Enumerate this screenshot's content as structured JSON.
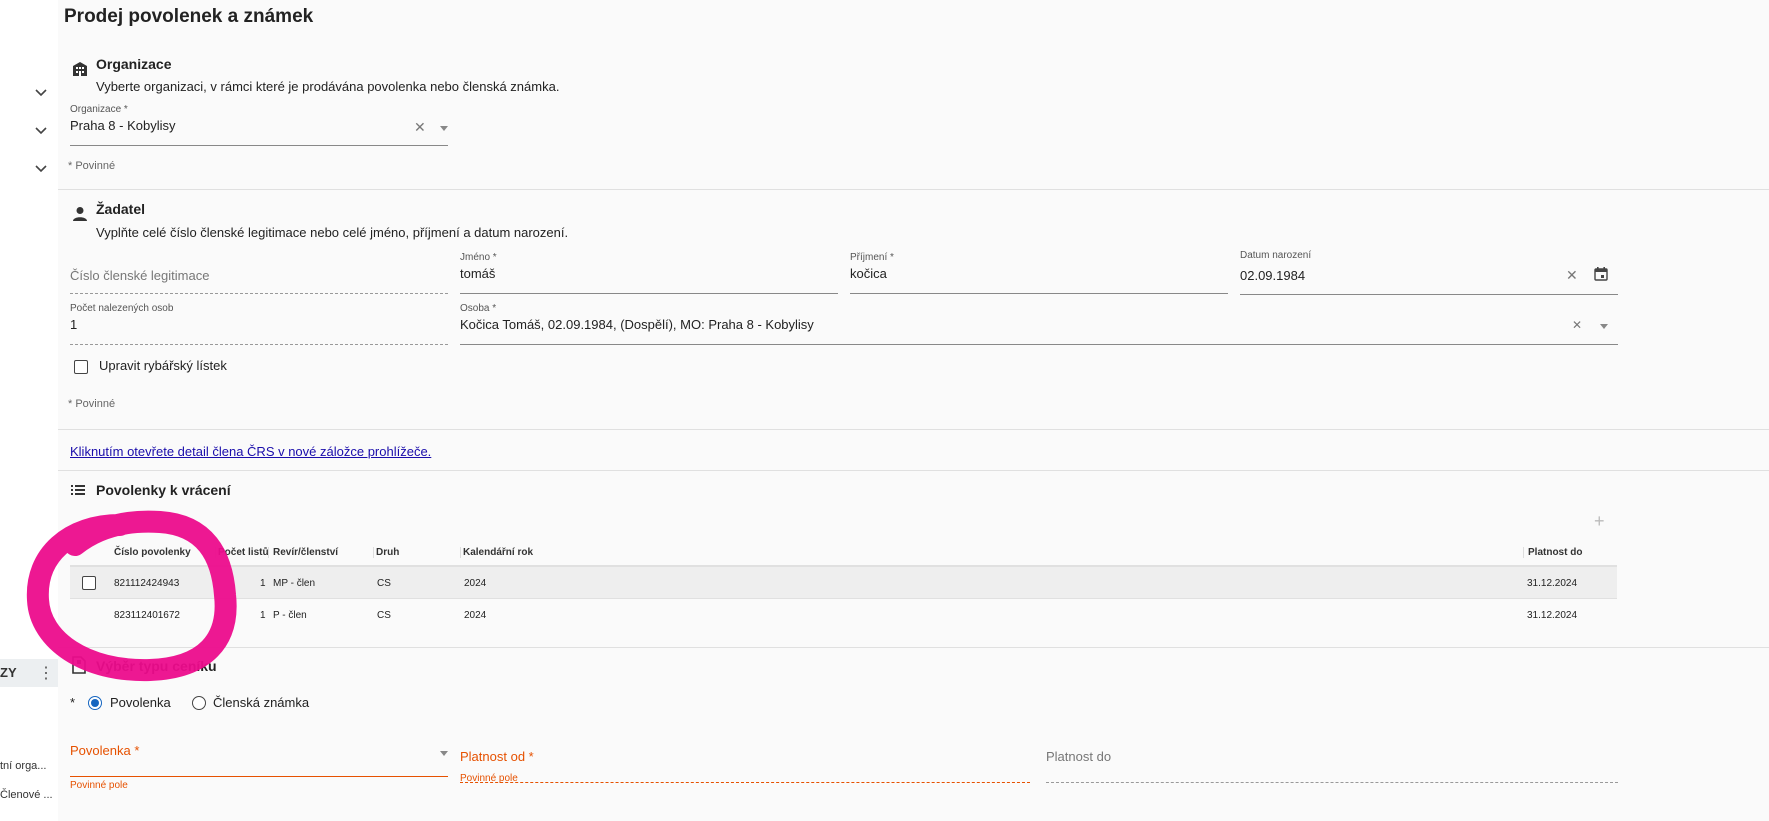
{
  "sidebar": {
    "menu_label": "ZY",
    "items": [
      "tní orga...",
      "Členové ..."
    ]
  },
  "page": {
    "title": "Prodej povolenek a známek"
  },
  "organizace": {
    "title": "Organizace",
    "desc": "Vyberte organizaci, v rámci které je prodávána povolenka nebo členská známka.",
    "field_label": "Organizace *",
    "field_value": "Praha 8 - Kobylisy",
    "required_note": "* Povinné"
  },
  "zadatel": {
    "title": "Žadatel",
    "desc": "Vyplňte celé číslo členské legitimace nebo celé jméno, příjmení a datum narození.",
    "cislo_placeholder": "Číslo členské legitimace",
    "jmeno_label": "Jméno *",
    "jmeno_value": "tomáš",
    "prijmeni_label": "Příjmení *",
    "prijmeni_value": "kočica",
    "datum_label": "Datum narození",
    "datum_value": "02.09.1984",
    "pocet_label": "Počet nalezených osob",
    "pocet_value": "1",
    "osoba_label": "Osoba *",
    "osoba_value": "Kočica Tomáš, 02.09.1984, (Dospělí), MO: Praha 8 - Kobylisy",
    "checkbox_label": "Upravit rybářský lístek",
    "required_note": "* Povinné"
  },
  "link": {
    "text": "Kliknutím otevřete detail člena ČRS v nové záložce prohlížeče."
  },
  "povolenky": {
    "title": "Povolenky k vrácení",
    "add_symbol": "+",
    "columns": [
      "Číslo povolenky",
      "Počet listů",
      "Revír/členství",
      "Druh",
      "Kalendářní rok",
      "Platnost do"
    ],
    "rows": [
      {
        "cislo": "821112424943",
        "pocet": "1",
        "revir": "MP - člen",
        "druh": "CS",
        "rok": "2024",
        "platnost": "31.12.2024"
      },
      {
        "cislo": "823112401672",
        "pocet": "1",
        "revir": "P - člen",
        "druh": "CS",
        "rok": "2024",
        "platnost": "31.12.2024"
      }
    ]
  },
  "cenik": {
    "title": "Výběr typu ceníku",
    "asterisk": "*",
    "options": [
      "Povolenka",
      "Členská známka"
    ],
    "selected": "Povolenka",
    "povolenka_label": "Povolenka *",
    "platnost_od_label": "Platnost od *",
    "platnost_do_label": "Platnost do",
    "error_text": "Povinné pole"
  },
  "colors": {
    "accent": "#1565c0",
    "error": "#e65100",
    "annotation": "#ec0c8c"
  }
}
